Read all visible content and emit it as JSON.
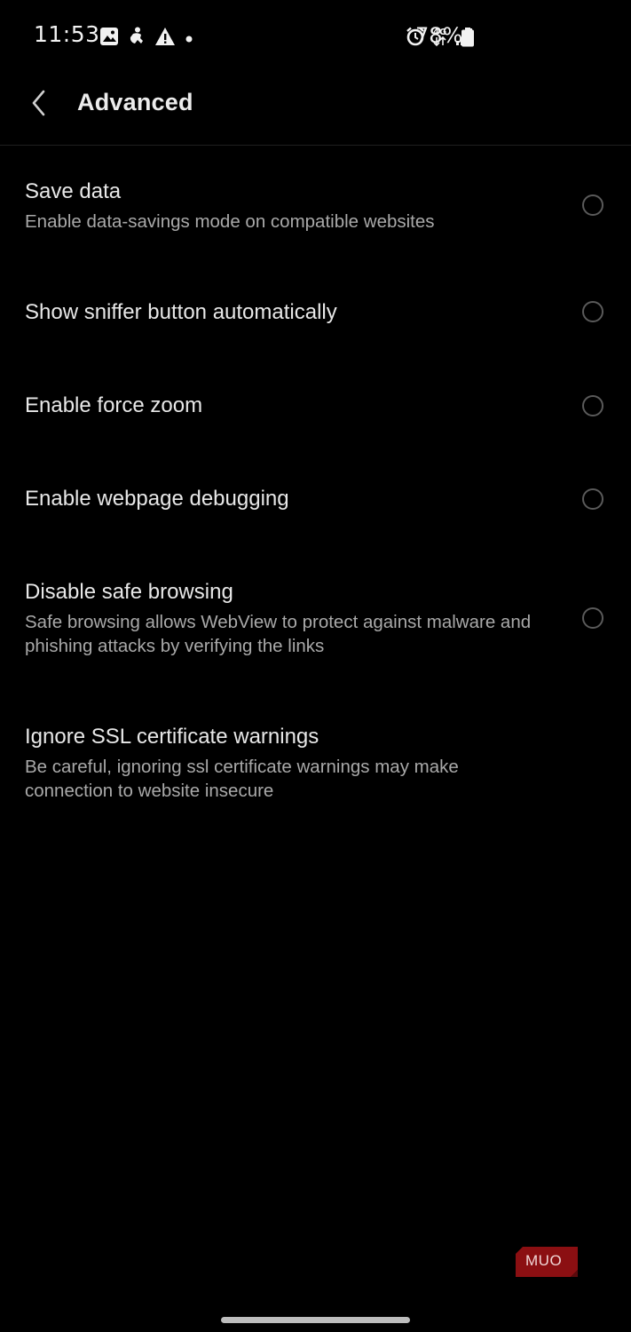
{
  "status_bar": {
    "time": "11:53",
    "battery_percent": "78%",
    "network_label": "4G",
    "left_icons": [
      "gallery-icon",
      "accessibility-icon",
      "warning-icon",
      "dot-icon"
    ],
    "right_icons": [
      "alarm-icon",
      "network-4g-icon",
      "signal-icon",
      "battery-icon"
    ]
  },
  "app_bar": {
    "title": "Advanced",
    "back_icon": "chevron-left-icon"
  },
  "settings": [
    {
      "title": "Save data",
      "description": "Enable data-savings mode on compatible websites",
      "has_radio": true,
      "checked": false
    },
    {
      "title": "Show sniffer button automatically",
      "description": "",
      "has_radio": true,
      "checked": false
    },
    {
      "title": "Enable force zoom",
      "description": "",
      "has_radio": true,
      "checked": false
    },
    {
      "title": "Enable webpage debugging",
      "description": "",
      "has_radio": true,
      "checked": false
    },
    {
      "title": "Disable safe browsing",
      "description": "Safe browsing allows WebView to protect against malware and phishing attacks by verifying the links",
      "has_radio": true,
      "checked": false
    },
    {
      "title": "Ignore SSL certificate warnings",
      "description": "Be careful, ignoring ssl certificate warnings may make connection to website insecure",
      "has_radio": false,
      "checked": false
    }
  ],
  "watermark": {
    "text": "MUO",
    "color": "#8b0f12"
  },
  "colors": {
    "background": "#000000",
    "title_text": "#e8e8e8",
    "description_text": "#a9a9a9",
    "radio_border": "#5a5a5a"
  }
}
